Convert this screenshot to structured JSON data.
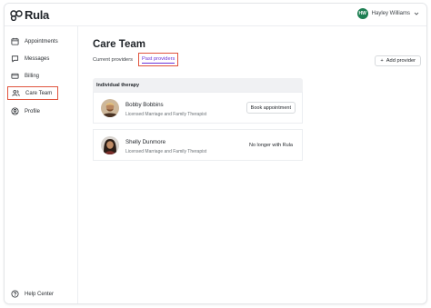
{
  "brand": {
    "name": "Rula"
  },
  "user": {
    "initials": "HW",
    "name": "Hayley Williams",
    "avatar_color": "#1e7f53"
  },
  "sidebar": {
    "items": [
      {
        "label": "Appointments",
        "icon": "calendar-icon"
      },
      {
        "label": "Messages",
        "icon": "message-icon"
      },
      {
        "label": "Billing",
        "icon": "card-icon"
      },
      {
        "label": "Care Team",
        "icon": "people-icon",
        "active": true
      },
      {
        "label": "Profile",
        "icon": "profile-icon"
      }
    ],
    "footer": {
      "label": "Help Center",
      "icon": "help-icon"
    }
  },
  "main": {
    "title": "Care Team",
    "tabs": [
      {
        "label": "Current providers"
      },
      {
        "label": "Past providers",
        "selected": true
      }
    ],
    "add_provider_label": "Add provider",
    "section": "Individual therapy",
    "providers": [
      {
        "name": "Bobby Bobbins",
        "role": "Licensed Marriage and Family Therapist",
        "action": "Book appointment"
      },
      {
        "name": "Shelly Dunmore",
        "role": "Licensed Marriage and Family Therapist",
        "status": "No longer with Rula"
      }
    ]
  },
  "colors": {
    "highlight": "#e0533d",
    "accent": "#6b35d9"
  }
}
